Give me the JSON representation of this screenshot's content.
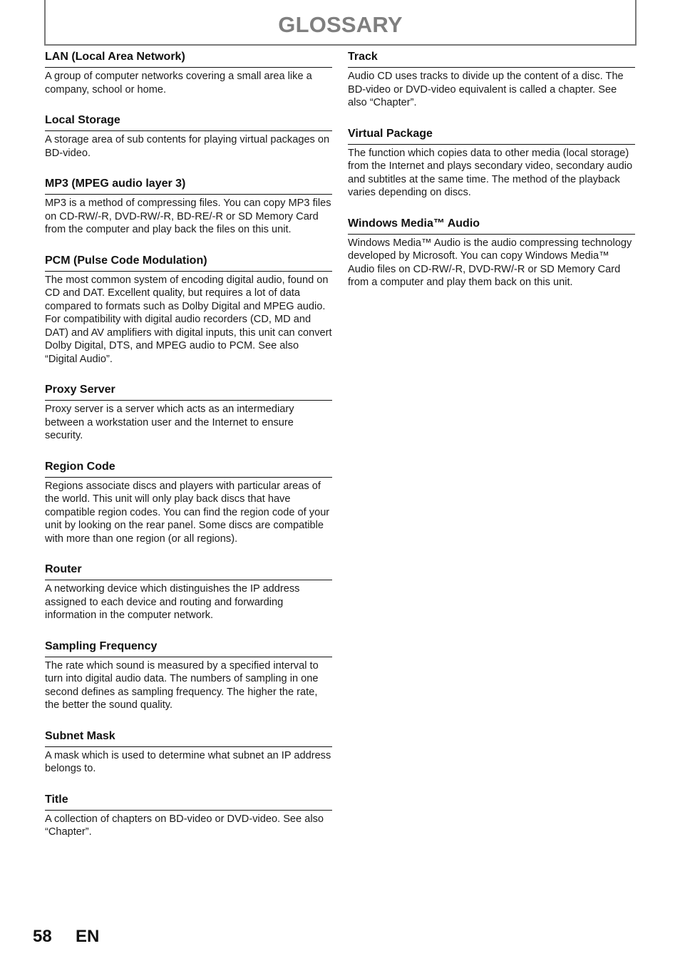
{
  "header": {
    "title": "GLOSSARY"
  },
  "left_column": [
    {
      "term": "LAN (Local Area Network)",
      "definition": "A group of computer networks covering a small area like a company, school or home."
    },
    {
      "term": "Local Storage",
      "definition": "A storage area of sub contents for playing virtual packages on BD-video."
    },
    {
      "term": "MP3 (MPEG audio layer 3)",
      "definition": "MP3 is a method of compressing files. You can copy MP3 files on CD-RW/-R, DVD-RW/-R, BD-RE/-R or SD Memory Card from the computer and play back the files on this unit."
    },
    {
      "term": "PCM (Pulse Code Modulation)",
      "definition": "The most common system of encoding digital audio, found on CD and DAT. Excellent quality, but requires a lot of data compared to formats such as Dolby Digital and MPEG audio. For compatibility with digital audio recorders (CD, MD and DAT) and AV amplifiers with digital inputs, this unit can convert Dolby Digital, DTS, and MPEG audio to PCM. See also “Digital Audio”."
    },
    {
      "term": "Proxy Server",
      "definition": "Proxy server is a server which acts as an intermediary between a workstation user and the Internet to ensure security."
    },
    {
      "term": "Region Code",
      "definition": "Regions associate discs and players with particular areas of the world. This unit will only play back discs that have compatible region codes. You can find the region code of your unit by looking on the rear panel. Some discs are compatible with more than one region (or all regions)."
    },
    {
      "term": "Router",
      "definition": "A networking device which distinguishes the IP address assigned to each device and routing and forwarding information in the computer network."
    },
    {
      "term": "Sampling Frequency",
      "definition": "The rate which sound is measured by a specified interval to turn into digital audio data. The numbers of sampling in one second defines as sampling frequency. The higher the rate, the better the sound quality."
    },
    {
      "term": "Subnet Mask",
      "definition": "A mask which is used to determine what subnet an IP address belongs to."
    },
    {
      "term": "Title",
      "definition": "A collection of chapters on BD-video or DVD-video. See also “Chapter”."
    }
  ],
  "right_column": [
    {
      "term": "Track",
      "definition": "Audio CD uses tracks to divide up the content of a disc. The BD-video or DVD-video equivalent is called a chapter. See also “Chapter”."
    },
    {
      "term": "Virtual Package",
      "definition": "The function which copies data to other media (local storage) from the Internet and plays secondary video, secondary audio and subtitles at the same time. The method of the playback varies depending on discs."
    },
    {
      "term": "Windows Media™ Audio",
      "definition": "Windows Media™ Audio is the audio compressing technology developed by Microsoft. You can copy Windows Media™ Audio files on CD-RW/-R, DVD-RW/-R or SD Memory Card from a computer and play them back on this unit."
    }
  ],
  "footer": {
    "page_number": "58",
    "language": "EN"
  }
}
